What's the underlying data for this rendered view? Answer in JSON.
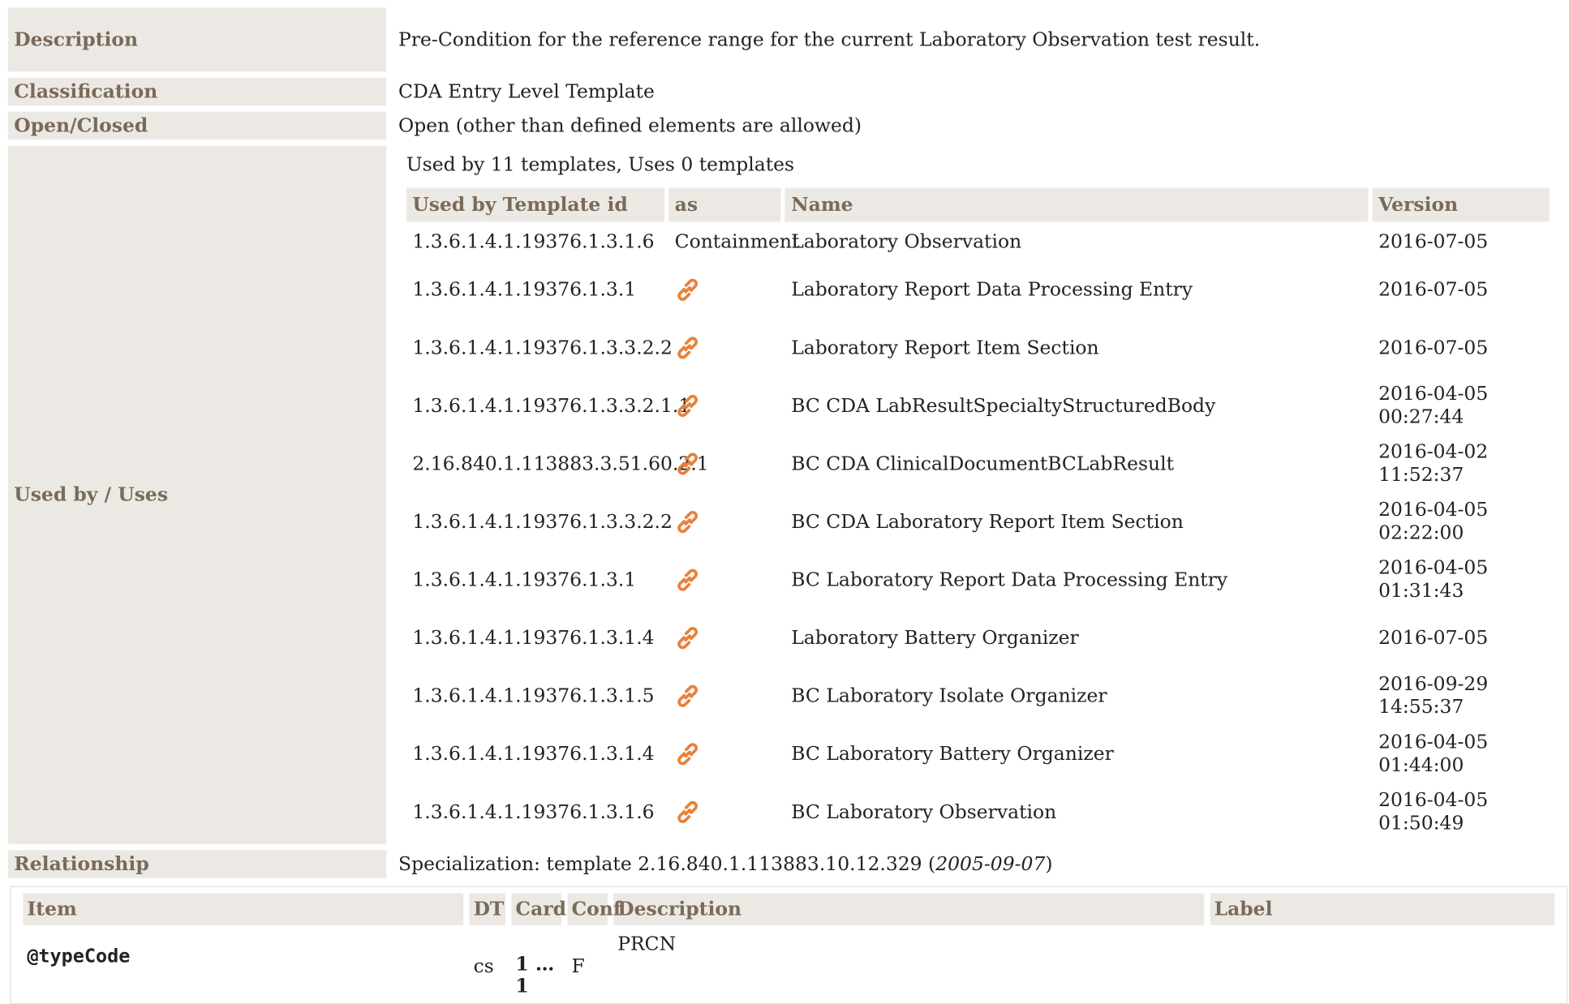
{
  "meta": {
    "description_label": "Description",
    "description_value": "Pre-Condition for the reference range for the current Laboratory Observation test result.",
    "classification_label": "Classification",
    "classification_value": "CDA Entry Level Template",
    "openclosed_label": "Open/Closed",
    "openclosed_value": "Open (other than defined elements are allowed)",
    "usedby_label": "Used by / Uses",
    "usedby_summary": "Used by 11 templates, Uses 0 templates",
    "relationship_label": "Relationship",
    "relationship_prefix": "Specialization: template 2.16.840.1.113883.10.12.329 (",
    "relationship_date": "2005-09-07",
    "relationship_suffix": ")"
  },
  "uses_table": {
    "headers": [
      "Used by Template id",
      "as",
      "Name",
      "Version"
    ],
    "rows": [
      {
        "id": "1.3.6.1.4.1.19376.1.3.1.6",
        "as": "Containment",
        "name": "Laboratory Observation",
        "version": "2016-07-05",
        "time": ""
      },
      {
        "id": "1.3.6.1.4.1.19376.1.3.1",
        "as": "link-icon",
        "name": "Laboratory Report Data Processing Entry",
        "version": "2016-07-05",
        "time": ""
      },
      {
        "id": "1.3.6.1.4.1.19376.1.3.3.2.2",
        "as": "link-icon",
        "name": "Laboratory Report Item Section",
        "version": "2016-07-05",
        "time": ""
      },
      {
        "id": "1.3.6.1.4.1.19376.1.3.3.2.1.1",
        "as": "link-icon",
        "name": "BC CDA LabResultSpecialtyStructuredBody",
        "version": "2016-04-05",
        "time": "00:27:44"
      },
      {
        "id": "2.16.840.1.113883.3.51.60.2.1",
        "as": "link-icon",
        "name": "BC CDA ClinicalDocumentBCLabResult",
        "version": "2016-04-02",
        "time": "11:52:37"
      },
      {
        "id": "1.3.6.1.4.1.19376.1.3.3.2.2",
        "as": "link-icon",
        "name": "BC CDA Laboratory Report Item Section",
        "version": "2016-04-05",
        "time": "02:22:00"
      },
      {
        "id": "1.3.6.1.4.1.19376.1.3.1",
        "as": "link-icon",
        "name": "BC Laboratory Report Data Processing Entry",
        "version": "2016-04-05",
        "time": "01:31:43"
      },
      {
        "id": "1.3.6.1.4.1.19376.1.3.1.4",
        "as": "link-icon",
        "name": "Laboratory Battery Organizer",
        "version": "2016-07-05",
        "time": ""
      },
      {
        "id": "1.3.6.1.4.1.19376.1.3.1.5",
        "as": "link-icon",
        "name": "BC Laboratory Isolate Organizer",
        "version": "2016-09-29",
        "time": "14:55:37"
      },
      {
        "id": "1.3.6.1.4.1.19376.1.3.1.4",
        "as": "link-icon",
        "name": "BC Laboratory Battery Organizer",
        "version": "2016-04-05",
        "time": "01:44:00"
      },
      {
        "id": "1.3.6.1.4.1.19376.1.3.1.6",
        "as": "link-icon",
        "name": "BC Laboratory Observation",
        "version": "2016-04-05",
        "time": "01:50:49"
      }
    ]
  },
  "items_table": {
    "headers": {
      "item": "Item",
      "dt": "DT",
      "card": "Card",
      "conf": "Conf",
      "description": "Description",
      "label": "Label"
    },
    "row": {
      "item": "@typeCode",
      "dt": "cs",
      "card": "1 … 1",
      "conf": "F",
      "description": "PRCN",
      "label": ""
    }
  },
  "colors": {
    "header_bg": "#ece9e4",
    "header_text": "#7a6a5a",
    "link_icon": "#e8803a"
  }
}
